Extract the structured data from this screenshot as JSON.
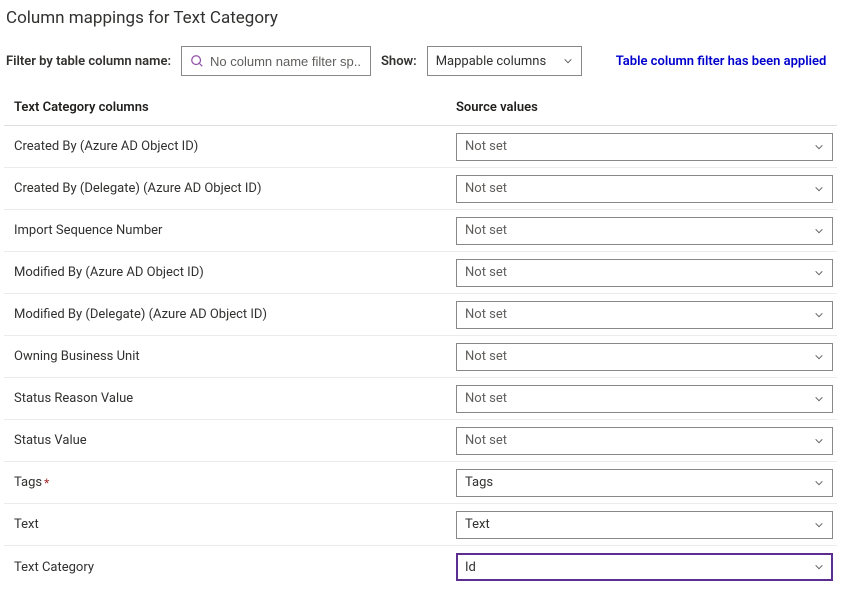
{
  "page_title": "Column mappings for Text Category",
  "filter": {
    "label": "Filter by table column name:",
    "placeholder": "No column name filter sp..."
  },
  "show": {
    "label": "Show:",
    "value": "Mappable columns"
  },
  "filter_applied_text": "Table column filter has been applied",
  "headers": {
    "col1": "Text Category columns",
    "col2": "Source values"
  },
  "rows": [
    {
      "label": "Created By (Azure AD Object ID)",
      "required": false,
      "value": "Not set",
      "notset": true,
      "selected": false
    },
    {
      "label": "Created By (Delegate) (Azure AD Object ID)",
      "required": false,
      "value": "Not set",
      "notset": true,
      "selected": false
    },
    {
      "label": "Import Sequence Number",
      "required": false,
      "value": "Not set",
      "notset": true,
      "selected": false
    },
    {
      "label": "Modified By (Azure AD Object ID)",
      "required": false,
      "value": "Not set",
      "notset": true,
      "selected": false
    },
    {
      "label": "Modified By (Delegate) (Azure AD Object ID)",
      "required": false,
      "value": "Not set",
      "notset": true,
      "selected": false
    },
    {
      "label": "Owning Business Unit",
      "required": false,
      "value": "Not set",
      "notset": true,
      "selected": false
    },
    {
      "label": "Status Reason Value",
      "required": false,
      "value": "Not set",
      "notset": true,
      "selected": false
    },
    {
      "label": "Status Value",
      "required": false,
      "value": "Not set",
      "notset": true,
      "selected": false
    },
    {
      "label": "Tags",
      "required": true,
      "value": "Tags",
      "notset": false,
      "selected": false
    },
    {
      "label": "Text",
      "required": false,
      "value": "Text",
      "notset": false,
      "selected": false
    },
    {
      "label": "Text Category",
      "required": false,
      "value": "Id",
      "notset": false,
      "selected": true
    }
  ]
}
